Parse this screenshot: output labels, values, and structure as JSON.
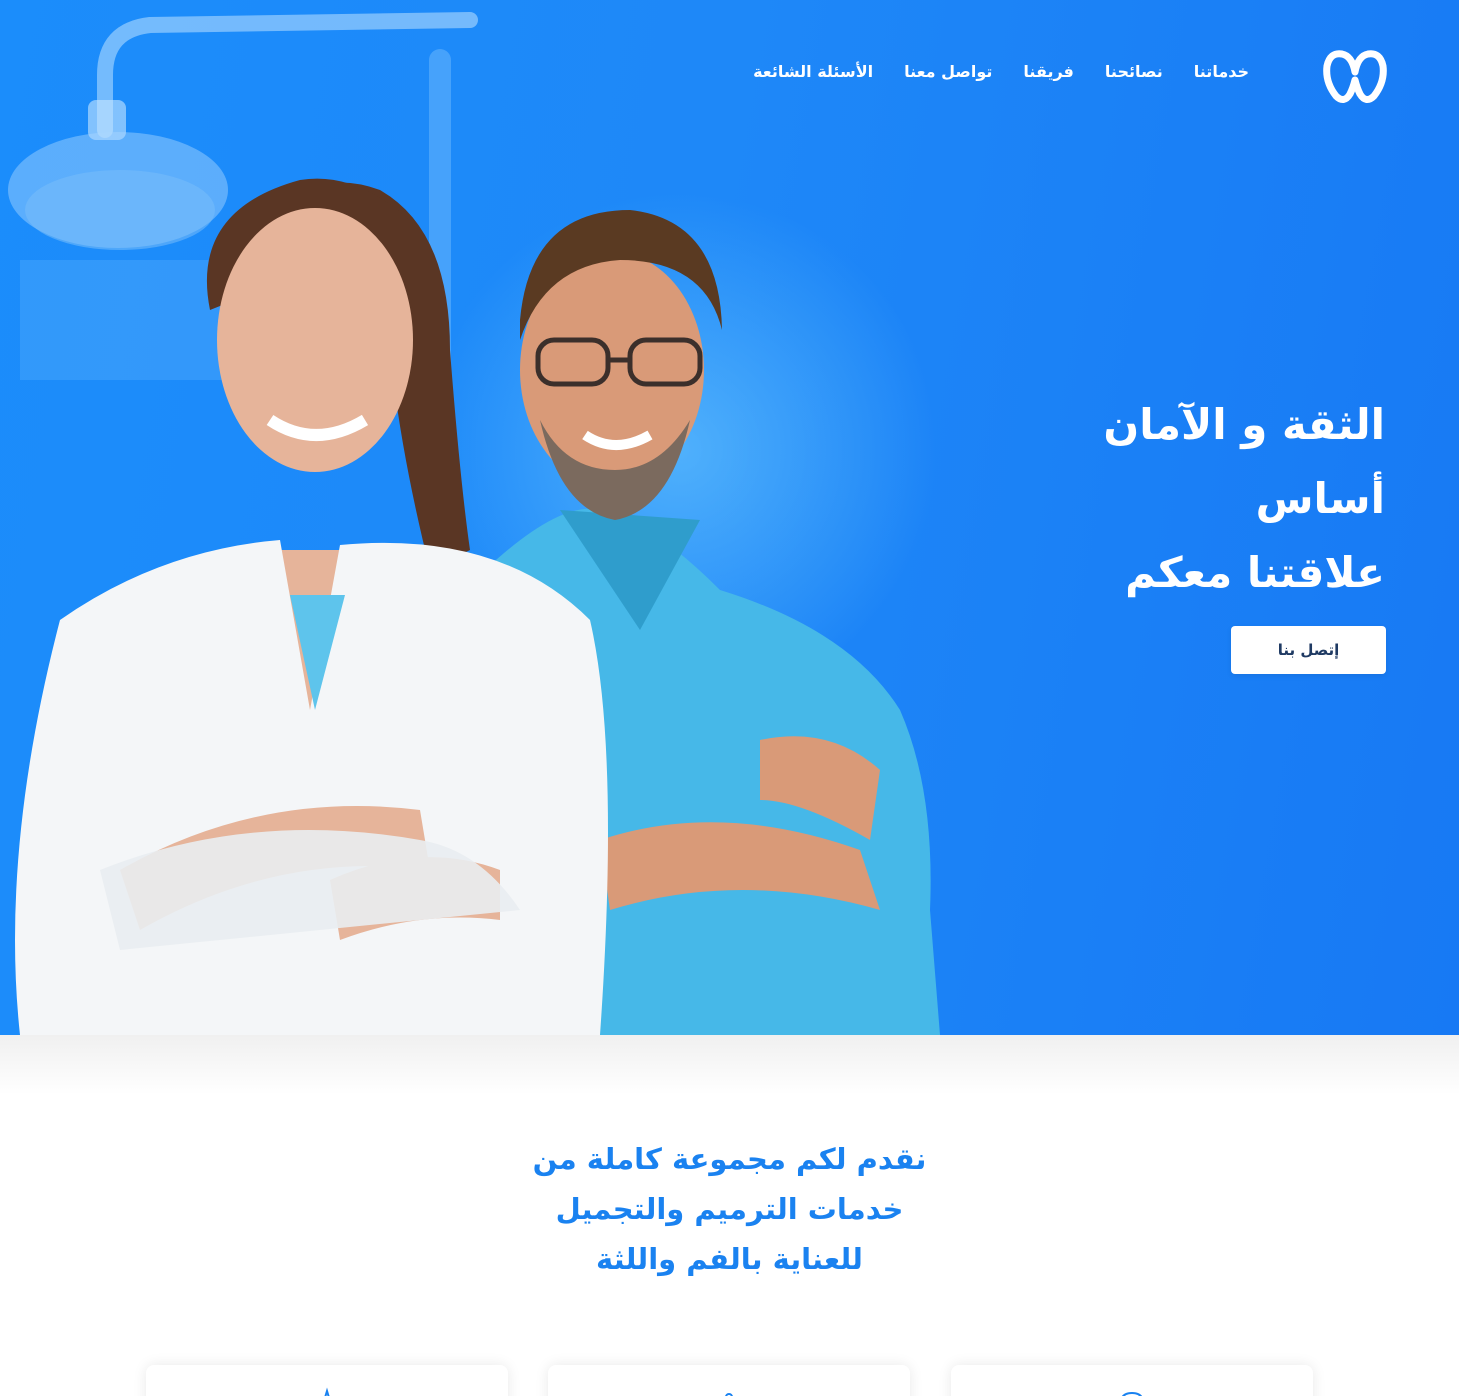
{
  "nav": {
    "items": [
      {
        "label": "خدماتنا"
      },
      {
        "label": "نصائحنا"
      },
      {
        "label": "فريقنا"
      },
      {
        "label": "تواصل معنا"
      },
      {
        "label": "الأسئلة الشائعة"
      }
    ],
    "logo_icon": "tooth-logo-icon"
  },
  "hero": {
    "headline_lines": [
      "الثقة و الآمان",
      "أساس",
      "علاقتنا معكم"
    ],
    "cta_label": "إتصل بنا"
  },
  "services": {
    "title_lines": [
      "نقدم لكم مجموعة كاملة من",
      "خدمات الترميم والتجميل",
      "للعناية بالفم واللثة"
    ]
  },
  "colors": {
    "hero_blue": "#1e88f8",
    "accent_blue": "#1a82f0",
    "white": "#ffffff",
    "cta_text": "#1f3a63"
  }
}
